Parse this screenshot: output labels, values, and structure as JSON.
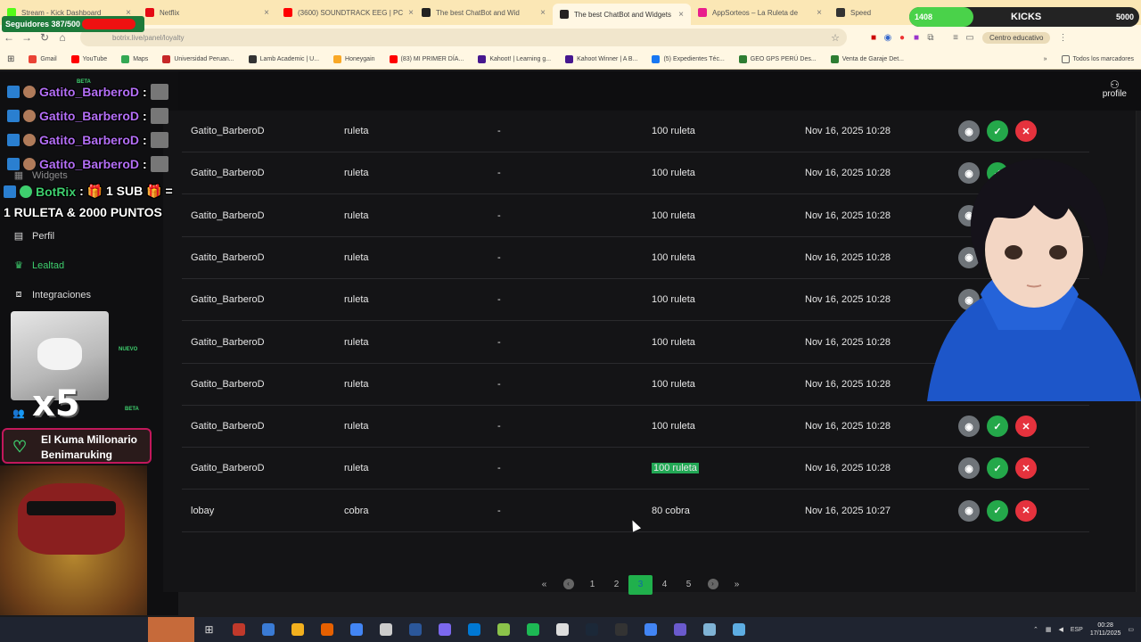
{
  "browser": {
    "tabs": [
      {
        "title": "Stream - Kick Dashboard",
        "color": "#53fc18"
      },
      {
        "title": "Netflix",
        "color": "#e50914"
      },
      {
        "title": "(3600) SOUNDTRACK EEG | PC",
        "color": "#ff0000"
      },
      {
        "title": "The best ChatBot and Wid",
        "color": "#222222"
      },
      {
        "title": "The best ChatBot and Widgets",
        "color": "#222222",
        "active": true
      },
      {
        "title": "AppSorteos – La Ruleta de",
        "color": "#e91e8c"
      },
      {
        "title": "Speed",
        "color": "#333333"
      }
    ],
    "url": "botrix.live/panel/loyalty",
    "profile_pill": "Centro educativo",
    "bookmarks": [
      {
        "label": "Gmail",
        "color": "#ea4335"
      },
      {
        "label": "YouTube",
        "color": "#ff0000"
      },
      {
        "label": "Maps",
        "color": "#34a853"
      },
      {
        "label": "Universidad Peruan...",
        "color": "#c62828"
      },
      {
        "label": "Lamb Academic | U...",
        "color": "#333333"
      },
      {
        "label": "Honeygain",
        "color": "#f9a825"
      },
      {
        "label": "(83) MI PRIMER DÍA...",
        "color": "#ff0000"
      },
      {
        "label": "Kahoot! | Learning g...",
        "color": "#46178f"
      },
      {
        "label": "Kahoot Winner | A B...",
        "color": "#46178f"
      },
      {
        "label": "(5) Expedientes Téc...",
        "color": "#1877f2"
      },
      {
        "label": "GEO GPS PERÚ Des...",
        "color": "#2e7d32"
      },
      {
        "label": "Venta de Garaje Det...",
        "color": "#2e7d32"
      }
    ],
    "bookmarks_all": "Todos los marcadores"
  },
  "overlay": {
    "followers": "Seguidores 387/500",
    "kicks_label": "KICKS",
    "kicks_current": "1408",
    "kicks_goal": "5000",
    "kicks_progress": 0.28
  },
  "sidebar": {
    "items": [
      {
        "label": "Widgets",
        "icon": "widget-icon"
      },
      {
        "label": "Perfil",
        "icon": "card-icon"
      },
      {
        "label": "Lealtad",
        "icon": "trophy-icon",
        "active": true
      },
      {
        "label": "Integraciones",
        "icon": "plug-icon"
      }
    ],
    "badges": {
      "beta": "BETA",
      "nuevo": "NUEVO"
    }
  },
  "header": {
    "profile_label": "profile"
  },
  "table": {
    "rows": [
      {
        "user": "Gatito_BarberoD",
        "type": "ruleta",
        "message": "-",
        "item": "100 ruleta",
        "date": "Nov 16, 2025 10:28"
      },
      {
        "user": "Gatito_BarberoD",
        "type": "ruleta",
        "message": "-",
        "item": "100 ruleta",
        "date": "Nov 16, 2025 10:28"
      },
      {
        "user": "Gatito_BarberoD",
        "type": "ruleta",
        "message": "-",
        "item": "100 ruleta",
        "date": "Nov 16, 2025 10:28"
      },
      {
        "user": "Gatito_BarberoD",
        "type": "ruleta",
        "message": "-",
        "item": "100 ruleta",
        "date": "Nov 16, 2025 10:28"
      },
      {
        "user": "Gatito_BarberoD",
        "type": "ruleta",
        "message": "-",
        "item": "100 ruleta",
        "date": "Nov 16, 2025 10:28"
      },
      {
        "user": "Gatito_BarberoD",
        "type": "ruleta",
        "message": "-",
        "item": "100 ruleta",
        "date": "Nov 16, 2025 10:28"
      },
      {
        "user": "Gatito_BarberoD",
        "type": "ruleta",
        "message": "-",
        "item": "100 ruleta",
        "date": "Nov 16, 2025 10:28"
      },
      {
        "user": "Gatito_BarberoD",
        "type": "ruleta",
        "message": "-",
        "item": "100 ruleta",
        "date": "Nov 16, 2025 10:28"
      },
      {
        "user": "Gatito_BarberoD",
        "type": "ruleta",
        "message": "-",
        "item": "100 ruleta",
        "date": "Nov 16, 2025 10:28",
        "highlight": true
      },
      {
        "user": "lobay",
        "type": "cobra",
        "message": "-",
        "item": "80 cobra",
        "date": "Nov 16, 2025 10:27"
      }
    ]
  },
  "pagination": {
    "first": "«",
    "prev": "‹",
    "pages": [
      "1",
      "2",
      "3",
      "4",
      "5"
    ],
    "current": "3",
    "next": "›",
    "last": "»"
  },
  "chat": {
    "lines": [
      {
        "user": "Gatito_BarberoD",
        "sep": ":"
      },
      {
        "user": "Gatito_BarberoD",
        "sep": ":"
      },
      {
        "user": "Gatito_BarberoD",
        "sep": ":"
      },
      {
        "user": "Gatito_BarberoD",
        "sep": ":"
      }
    ],
    "bot_user": "BotRix",
    "bot_msg_1": ": 🎁 1 SUB 🎁 =",
    "bot_msg_2": "1 RULETA & 2000 PUNTOS"
  },
  "alert": {
    "multiplier": "x5"
  },
  "donor": {
    "line1": "El Kuma Millonario",
    "line2": "Benimaruking"
  },
  "taskbar": {
    "apps": [
      "#c0392b",
      "#3a7bd5",
      "#f2b01e",
      "#e66000",
      "#4285f4",
      "#cccccc",
      "#2b579a",
      "#7b68ee",
      "#0078d4",
      "#8bc34a",
      "#1db954",
      "#dddddd",
      "#1b2838",
      "#333333",
      "#4285f4",
      "#6a5acd",
      "#7fb3d5",
      "#5dade2"
    ],
    "lang": "ESP",
    "time": "00:28",
    "date": "17/11/2025"
  }
}
